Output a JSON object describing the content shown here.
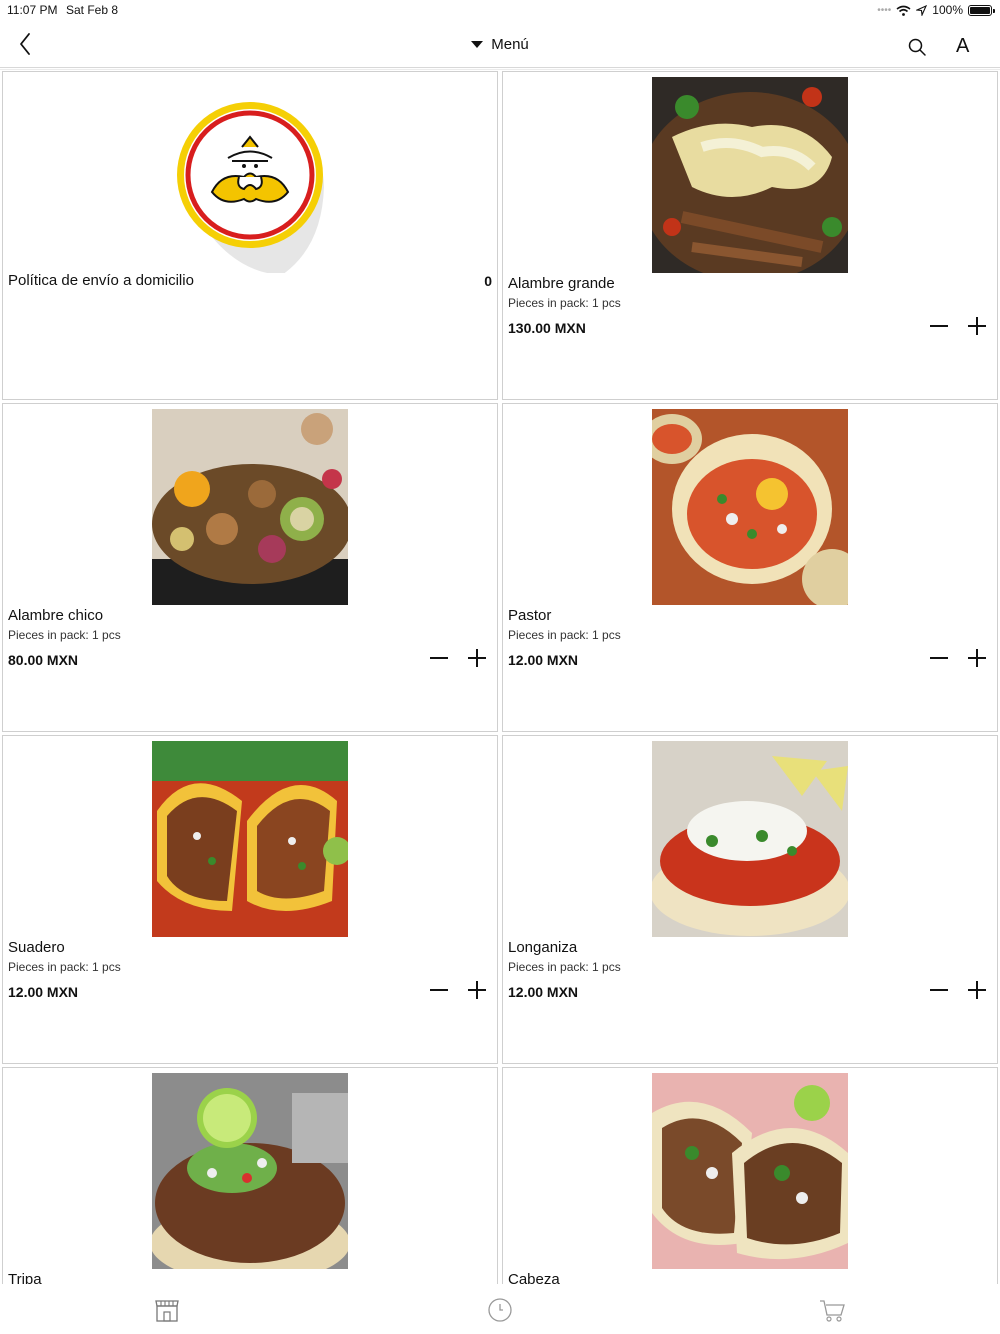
{
  "status_bar": {
    "time": "11:07 PM",
    "date": "Sat Feb 8",
    "battery": "100%"
  },
  "nav": {
    "title": "Menú",
    "icons": [
      "back-chevron-icon",
      "caret-down-icon",
      "search-icon",
      "font-size-icon"
    ],
    "font_button": "A"
  },
  "policy_card": {
    "name": "Política de envío a domicilio",
    "count": "0",
    "logo_colors": {
      "ring_outer": "#f5cf05",
      "ring_inner": "#d81e1e",
      "mustache": "#f4c400"
    }
  },
  "products": [
    {
      "name": "Alambre grande",
      "pieces": "Pieces in pack: 1 pcs",
      "price": "130.00 MXN"
    },
    {
      "name": "Alambre chico",
      "pieces": "Pieces in pack: 1 pcs",
      "price": "80.00 MXN"
    },
    {
      "name": "Pastor",
      "pieces": "Pieces in pack: 1 pcs",
      "price": "12.00 MXN"
    },
    {
      "name": "Suadero",
      "pieces": "Pieces in pack: 1 pcs",
      "price": "12.00 MXN"
    },
    {
      "name": "Longaniza",
      "pieces": "Pieces in pack: 1 pcs",
      "price": "12.00 MXN"
    },
    {
      "name": "Tripa"
    },
    {
      "name": "Cabeza"
    }
  ],
  "tab_bar": {
    "icons": [
      "store-icon",
      "clock-icon",
      "cart-icon"
    ]
  }
}
